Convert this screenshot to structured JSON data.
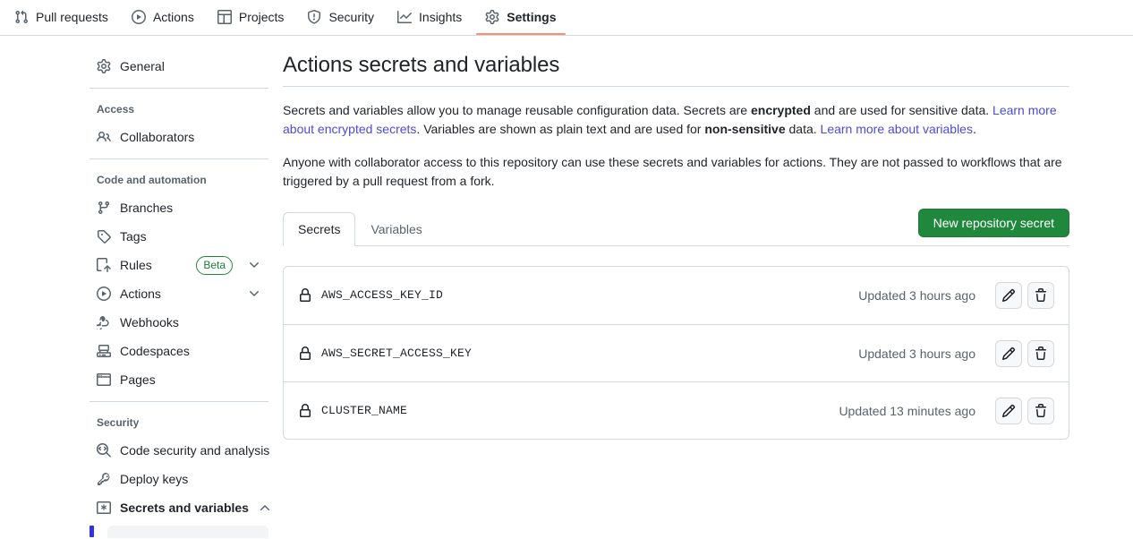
{
  "topnav": {
    "items": [
      {
        "label": "Pull requests",
        "icon": "git-pull-request-icon",
        "active": false
      },
      {
        "label": "Actions",
        "icon": "play-circle-icon",
        "active": false
      },
      {
        "label": "Projects",
        "icon": "table-icon",
        "active": false
      },
      {
        "label": "Security",
        "icon": "shield-icon",
        "active": false
      },
      {
        "label": "Insights",
        "icon": "graph-icon",
        "active": false
      },
      {
        "label": "Settings",
        "icon": "gear-icon",
        "active": true
      }
    ]
  },
  "sidebar": {
    "general": {
      "label": "General",
      "icon": "gear-icon"
    },
    "access_heading": "Access",
    "collaborators": {
      "label": "Collaborators",
      "icon": "people-icon"
    },
    "code_heading": "Code and automation",
    "code_items": [
      {
        "label": "Branches",
        "icon": "git-branch-icon"
      },
      {
        "label": "Tags",
        "icon": "tag-icon"
      },
      {
        "label": "Rules",
        "icon": "rules-icon",
        "badge": "Beta",
        "chevron": "chevron-down-icon"
      },
      {
        "label": "Actions",
        "icon": "play-circle-icon",
        "chevron": "chevron-down-icon"
      },
      {
        "label": "Webhooks",
        "icon": "webhook-icon"
      },
      {
        "label": "Codespaces",
        "icon": "codespaces-icon"
      },
      {
        "label": "Pages",
        "icon": "browser-icon"
      }
    ],
    "security_heading": "Security",
    "security_items": [
      {
        "label": "Code security and analysis",
        "icon": "code-scan-icon"
      },
      {
        "label": "Deploy keys",
        "icon": "key-icon"
      },
      {
        "label": "Secrets and variables",
        "icon": "asterisk-icon",
        "chevron": "chevron-up-icon",
        "selected": true
      }
    ]
  },
  "main": {
    "title": "Actions secrets and variables",
    "intro": {
      "part1": "Secrets and variables allow you to manage reusable configuration data. Secrets are ",
      "bold1": "encrypted",
      "part2": " and are used for sensitive data. ",
      "link1": "Learn more about encrypted secrets",
      "part3": ". Variables are shown as plain text and are used for ",
      "bold2": "non-sensitive",
      "part4": " data. ",
      "link2": "Learn more about variables",
      "part5": "."
    },
    "note": "Anyone with collaborator access to this repository can use these secrets and variables for actions. They are not passed to workflows that are triggered by a pull request from a fork.",
    "tabs": [
      {
        "label": "Secrets",
        "active": true
      },
      {
        "label": "Variables",
        "active": false
      }
    ],
    "new_secret_button": "New repository secret",
    "secrets": [
      {
        "name": "AWS_ACCESS_KEY_ID",
        "updated": "Updated 3 hours ago",
        "lock_icon": "lock-icon",
        "edit_icon": "pencil-icon",
        "delete_icon": "trash-icon"
      },
      {
        "name": "AWS_SECRET_ACCESS_KEY",
        "updated": "Updated 3 hours ago",
        "lock_icon": "lock-icon",
        "edit_icon": "pencil-icon",
        "delete_icon": "trash-icon"
      },
      {
        "name": "CLUSTER_NAME",
        "updated": "Updated 13 minutes ago",
        "lock_icon": "lock-icon",
        "edit_icon": "pencil-icon",
        "delete_icon": "trash-icon"
      }
    ]
  },
  "colors": {
    "accent_green": "#1f883d",
    "active_tab_underline": "#fd8c73",
    "link": "#4b4bdc",
    "border": "#d1d9e0",
    "muted_text": "#59636e",
    "active_indicator": "#3333dd"
  }
}
